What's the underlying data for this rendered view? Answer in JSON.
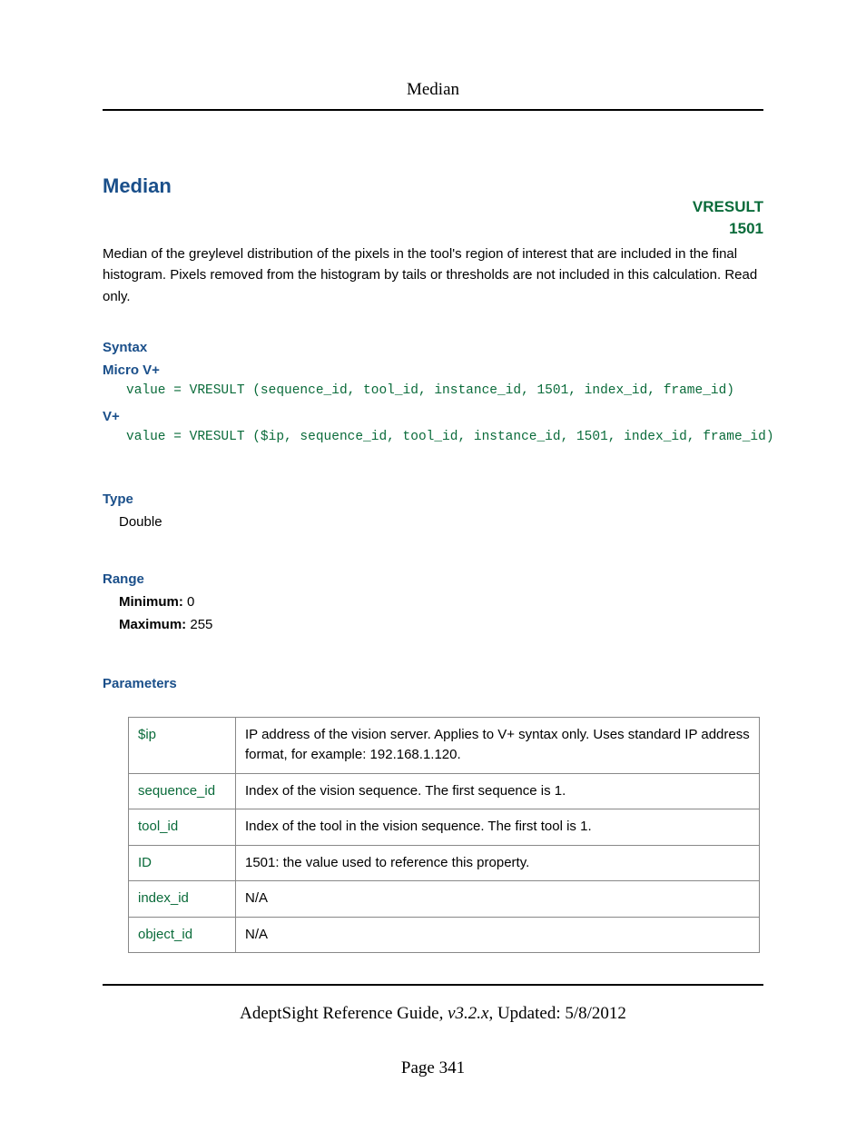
{
  "header": {
    "title": "Median"
  },
  "title": "Median",
  "badge": {
    "line1": "VRESULT",
    "line2": "1501"
  },
  "description": "Median of the greylevel distribution of the pixels in the tool's region of interest that are included in the final histogram. Pixels removed from the histogram by tails or thresholds are not included in this calculation. Read only.",
  "syntax": {
    "heading": "Syntax",
    "micro_label": "Micro V+",
    "micro_code": "value = VRESULT (sequence_id, tool_id, instance_id, 1501, index_id, frame_id)",
    "vplus_label": "V+",
    "vplus_code": "value = VRESULT ($ip, sequence_id, tool_id, instance_id, 1501, index_id, frame_id)"
  },
  "type": {
    "heading": "Type",
    "value": "Double"
  },
  "range": {
    "heading": "Range",
    "min_label": "Minimum:",
    "min_value": "0",
    "max_label": "Maximum:",
    "max_value": "255"
  },
  "parameters": {
    "heading": "Parameters",
    "rows": [
      {
        "name": "$ip",
        "desc": "IP address of the vision server. Applies to V+ syntax only. Uses standard IP address format, for example: 192.168.1.120."
      },
      {
        "name": "sequence_id",
        "desc": "Index of the vision sequence. The first sequence is 1."
      },
      {
        "name": "tool_id",
        "desc": "Index of the tool in the vision sequence. The first tool is 1."
      },
      {
        "name": "ID",
        "desc": "1501: the value used to reference this property."
      },
      {
        "name": "index_id",
        "desc": "N/A"
      },
      {
        "name": "object_id",
        "desc": "N/A"
      }
    ]
  },
  "footer": {
    "doc_title": "AdeptSight Reference Guide",
    "version": ", v3.2.x",
    "updated": ", Updated: 5/8/2012",
    "page_label": "Page 341"
  }
}
